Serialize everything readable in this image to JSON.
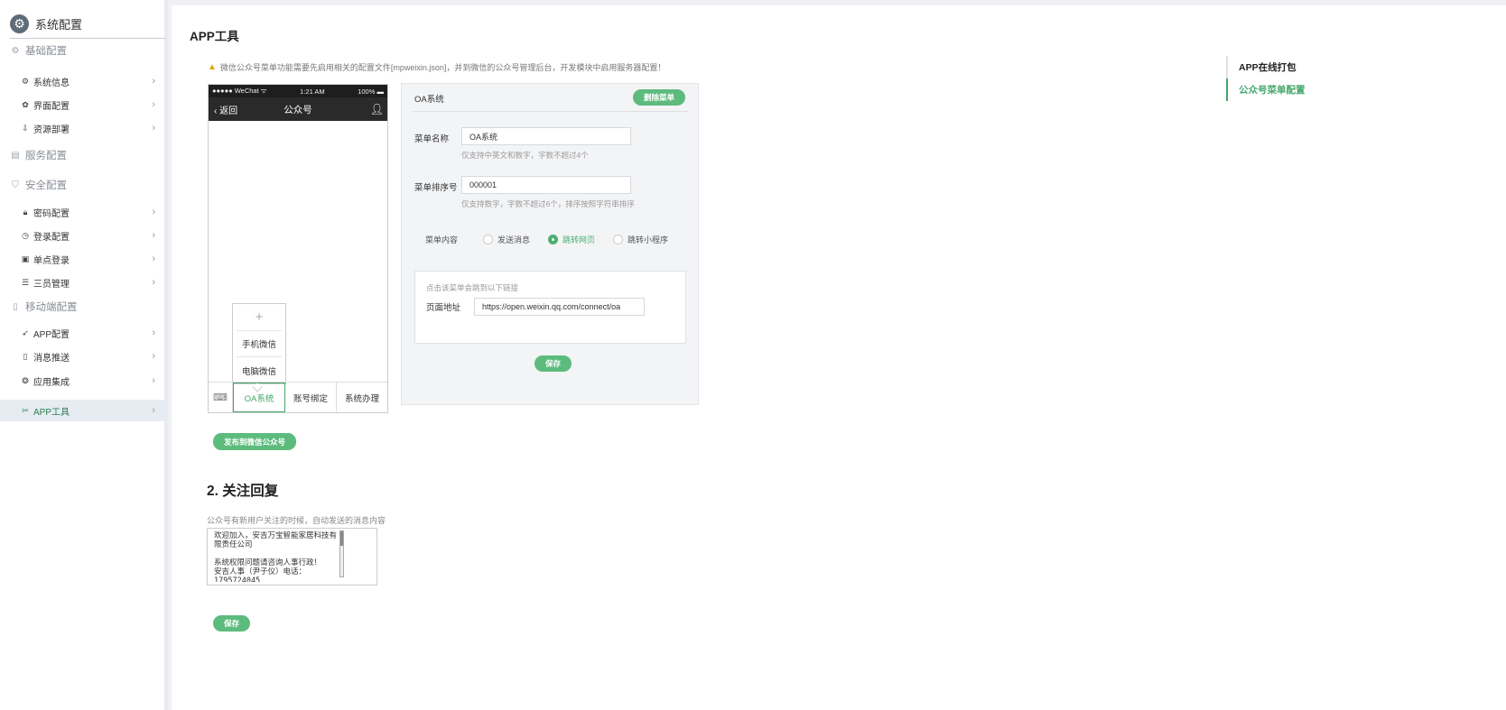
{
  "sidebar": {
    "title": "系统配置",
    "groups": [
      {
        "label": "基础配置",
        "items": [
          {
            "label": "系统信息"
          },
          {
            "label": "界面配置"
          },
          {
            "label": "资源部署"
          }
        ]
      },
      {
        "label": "服务配置",
        "items": []
      },
      {
        "label": "安全配置",
        "items": [
          {
            "label": "密码配置"
          },
          {
            "label": "登录配置"
          },
          {
            "label": "单点登录"
          },
          {
            "label": "三员管理"
          }
        ]
      },
      {
        "label": "移动端配置",
        "items": [
          {
            "label": "APP配置"
          },
          {
            "label": "消息推送"
          },
          {
            "label": "应用集成"
          },
          {
            "label": "APP工具",
            "active": true
          }
        ]
      }
    ]
  },
  "main": {
    "page_title": "APP工具",
    "warning": "微信公众号菜单功能需要先启用相关的配置文件[mpweixin.json]，并到微信的公众号管理后台，开发模块中启用服务器配置！",
    "phone": {
      "status_left": "●●●●● WeChat ᯤ",
      "status_time": "1:21 AM",
      "status_right": "100%",
      "back_label": "返回",
      "nav_title": "公众号",
      "submenu_plus": "+",
      "submenu_items": [
        "手机微信",
        "电脑微信"
      ],
      "tabs": [
        "OA系统",
        "账号绑定",
        "系统办理"
      ]
    },
    "panel": {
      "menu_name_title": "OA系统",
      "delete_button": "删除菜单",
      "name_label": "菜单名称",
      "name_value": "OA系统",
      "name_hint": "仅支持中英文和数字，字数不超过4个",
      "order_label": "菜单排序号",
      "order_value": "000001",
      "order_hint": "仅支持数字，字数不超过6个，排序按照字符串排序",
      "content_label": "菜单内容",
      "radio_options": [
        "发送消息",
        "跳转网页",
        "跳转小程序"
      ],
      "url_box_hint": "点击该菜单会跳到以下链接",
      "page_url_label": "页面地址",
      "page_url_value": "https://open.weixin.qq.com/connect/oa",
      "save_button": "保存"
    },
    "publish_button": "发布到微信公众号",
    "reply": {
      "section_title": "2. 关注回复",
      "description": "公众号有新用户关注的时候，自动发送的消息内容",
      "text": "欢迎加入，安吉万宝智能家居科技有限责任公司\n\n系统权限问题请咨询人事行政！\n安吉人事（尹子仪）电话：\n1795724045",
      "save_button": "保存"
    }
  },
  "toc": {
    "items": [
      "APP在线打包",
      "公众号菜单配置"
    ]
  }
}
